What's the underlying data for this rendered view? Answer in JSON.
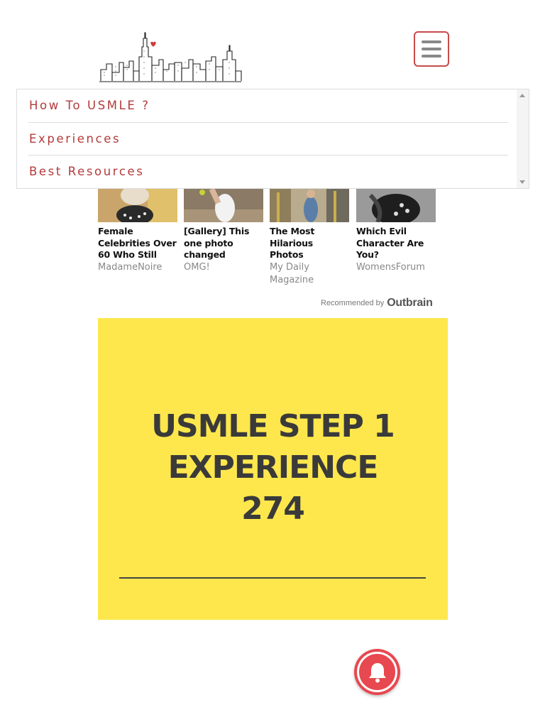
{
  "header": {
    "logo_icon": "city-skyline-logo-icon",
    "menu_icon": "hamburger-menu-icon"
  },
  "dropdown": {
    "items": [
      {
        "label": "How To USMLE ?"
      },
      {
        "label": "Experiences"
      },
      {
        "label": "Best Resources"
      }
    ]
  },
  "recommendations": {
    "items": [
      {
        "title": "Female Celebrities Over 60 Who Still",
        "source": "MadameNoire",
        "thumb_icon": "celebrity-photo-icon"
      },
      {
        "title": "[Gallery] This one photo changed",
        "source": "OMG!",
        "thumb_icon": "tennis-photo-icon"
      },
      {
        "title": "The Most Hilarious Photos Captured At The",
        "source": "My Daily Magazine",
        "thumb_icon": "street-photo-icon"
      },
      {
        "title": "Which Evil Character Are You?",
        "source": "WomensForum",
        "thumb_icon": "dark-character-photo-icon"
      }
    ],
    "credit_label": "Recommended by",
    "credit_brand": "Outbrain"
  },
  "feature": {
    "title_lines": [
      "USMLE STEP 1",
      "EXPERIENCE",
      "274"
    ],
    "background_color": "#fde74c",
    "text_color": "#3a3a3a"
  },
  "notification": {
    "icon": "bell-icon",
    "color": "#e8484f"
  },
  "colors": {
    "accent": "#b33a3a",
    "menu_border": "#c94a4a"
  }
}
